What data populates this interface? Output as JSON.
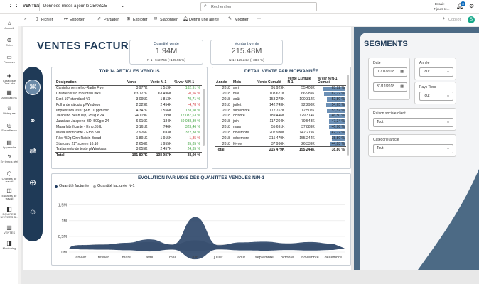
{
  "topbar": {
    "app": "VENTES",
    "data_updated": "Données mises à jour le 25/03/25",
    "search_placeholder": "Rechercher",
    "trial_line1": "Essai :",
    "trial_line2": "7 jours re...",
    "notif_count": "3"
  },
  "toolbar": {
    "fichier": "Fichier",
    "exporter": "Exporter",
    "partager": "Partager",
    "explorer": "Explorer",
    "abonner": "S'abonner",
    "alerte": "Définir une alerte",
    "modifier": "Modifier",
    "more": "···",
    "copilot": "Copilot"
  },
  "rail": [
    {
      "label": "Accueil",
      "icon": "home-icon",
      "glyph": "⌂"
    },
    {
      "label": "Créer",
      "icon": "plus-icon",
      "glyph": "⊕"
    },
    {
      "label": "Parcourir",
      "icon": "folder-icon",
      "glyph": "▭"
    },
    {
      "label": "Catalogue OneLake",
      "icon": "catalog-icon",
      "glyph": "◈"
    },
    {
      "label": "Applications",
      "icon": "apps-icon",
      "glyph": "▦"
    },
    {
      "label": "Métriques",
      "icon": "trophy-icon",
      "glyph": "♕"
    },
    {
      "label": "Surveillance",
      "icon": "monitor-icon",
      "glyph": "◎"
    },
    {
      "label": "Apprendre",
      "icon": "book-icon",
      "glyph": "▤"
    },
    {
      "label": "En temps réel",
      "icon": "lightning-icon",
      "glyph": "ϟ"
    },
    {
      "label": "Charges de travail",
      "icon": "workload-icon",
      "glyph": "⬡"
    },
    {
      "label": "Espaces de travail",
      "icon": "workspace-icon",
      "glyph": "◫"
    },
    {
      "label": "EQUIPE B UNIVERS B...",
      "icon": "workspace-b-icon",
      "glyph": "◧"
    },
    {
      "label": "VENTES",
      "icon": "report-icon",
      "glyph": "▥"
    },
    {
      "label": "Monitoring",
      "icon": "monitoring-icon",
      "glyph": "◨"
    }
  ],
  "report": {
    "title": "VENTES FACTURES",
    "kpi1": {
      "label": "Quantité vente",
      "value": "1.94M",
      "sub": "N-1 : 942.76K (+105.55 %)"
    },
    "kpi2": {
      "label": "Montant vente",
      "value": "215.48M",
      "sub": "N-1 : 155.24M (+38.8 %)"
    },
    "top_title": "TOP 14 ARTICLES VENDUS",
    "top_headers": [
      "Désignation",
      "Vente",
      "Vente N-1",
      "% var N/N-1"
    ],
    "top_rows": [
      [
        "Carrinho vermelho-Radio Flyer",
        "3 977K",
        "1 519K",
        "162,91 %",
        "pos"
      ],
      [
        "Children's std mountain bike",
        "63 127K",
        "63 496K",
        "-0,56 %",
        "neg"
      ],
      [
        "Ecrã 19\" standard 4/3",
        "3 095K",
        "1 813K",
        "70,71 %",
        "pos"
      ],
      [
        "Folha de cálculo p/Windows",
        "2 329K",
        "2 454K",
        "-4,78 %",
        "neg"
      ],
      [
        "Impressora laser p&b 10 ppm/min",
        "4 347K",
        "1 556K",
        "178,50 %",
        "pos"
      ],
      [
        "Jalapeno Bean Dip, 250g x 24",
        "24 119K",
        "199K",
        "12 087,63 %",
        "pos"
      ],
      [
        "Juanita's Jalapeno BD, 500g x 24",
        "6 016K",
        "184K",
        "50 038,39 %",
        "pos"
      ],
      [
        "Masa lubrificante - Emb.35 lb",
        "3 161K",
        "746K",
        "323,46 %",
        "pos"
      ],
      [
        "Masa lubrificante - Emb.5 lb",
        "2 926K",
        "693K",
        "322,38 %",
        "pos"
      ],
      [
        "Pão 450g Cinn Raisin Bread",
        "1 891K",
        "1 915K",
        "-1,35 %",
        "neg"
      ],
      [
        "Standard 22\" screen 16:10",
        "2 656K",
        "1 955K",
        "35,85 %",
        "pos"
      ],
      [
        "Tratamento de texto p/Windows",
        "3 055K",
        "2 457K",
        "24,35 %",
        "pos"
      ]
    ],
    "top_total": [
      "Total",
      "191 807K",
      "138 987K",
      "38,00 %"
    ],
    "detail_title": "DETAIL VENTE PAR MOIS/ANNÉE",
    "detail_headers": [
      "Année",
      "Mois",
      "Vente Cumulé",
      "Vente Cumulé N-1",
      "% var N/N-1 Cumulé"
    ],
    "detail_rows": [
      [
        "2018",
        "avril",
        "91 929K",
        "55 406K",
        "65,92 %",
        65.92
      ],
      [
        "2018",
        "mai",
        "108 671K",
        "66 989K",
        "62,22 %",
        62.22
      ],
      [
        "2018",
        "août",
        "153 278K",
        "100 312K",
        "52,80 %",
        52.8
      ],
      [
        "2018",
        "juillet",
        "142 743K",
        "92 298K",
        "54,65 %",
        54.65
      ],
      [
        "2018",
        "septembre",
        "172 767K",
        "112 502K",
        "53,57 %",
        53.57
      ],
      [
        "2018",
        "octobre",
        "189 446K",
        "129 314K",
        "46,50 %",
        46.5
      ],
      [
        "2018",
        "juin",
        "117 204K",
        "79 548K",
        "47,34 %",
        47.34
      ],
      [
        "2018",
        "mars",
        "55 691K",
        "37 889K",
        "46,98 %",
        46.98
      ],
      [
        "2018",
        "novembre",
        "202 980K",
        "142 219K",
        "42,72 %",
        42.72
      ],
      [
        "2018",
        "décembre",
        "215 479K",
        "155 244K",
        "38,80 %",
        38.8
      ],
      [
        "2018",
        "février",
        "37 936K",
        "26 339K",
        "44,03 %",
        44.03
      ]
    ],
    "detail_total": [
      "Total",
      "",
      "215 479K",
      "155 244K",
      "38,80 %"
    ],
    "chart_title": "EVOLUTION PAR MOIS DES QUANTITÉS VENDUES N/N-1"
  },
  "chart_data": {
    "type": "area",
    "title": "EVOLUTION PAR MOIS DES QUANTITÉS VENDUES N/N-1",
    "categories": [
      "janvier",
      "février",
      "mars",
      "avril",
      "mai",
      "juin",
      "juillet",
      "août",
      "septembre",
      "octobre",
      "novembre",
      "décembre"
    ],
    "series": [
      {
        "name": "Quantité facturée",
        "color": "#1f3a5f",
        "values": [
          0.02,
          0.05,
          0.15,
          0.35,
          0.05,
          1.65,
          0.02,
          0.18,
          0.22,
          0.12,
          0.2,
          0.1
        ]
      },
      {
        "name": "Quantité facturée N-1",
        "color": "#a5a5a5",
        "values": [
          0.03,
          0.08,
          0.12,
          0.2,
          0.06,
          0.3,
          0.05,
          0.1,
          0.14,
          0.1,
          0.12,
          0.08
        ]
      }
    ],
    "yticks": [
      "0M",
      "0,5M",
      "1M",
      "1,5M"
    ],
    "ytick_values": [
      0,
      0.5,
      1,
      1.5
    ],
    "ylim": [
      0,
      1.9
    ],
    "legend": "top-left"
  },
  "segments": {
    "title": "SEGMENTS",
    "date_label": "Date",
    "date_from": "01/01/2018",
    "date_to": "31/12/2018",
    "annee_label": "Année",
    "annee_value": "Tout",
    "pays_label": "Pays Tiers",
    "pays_value": "Tout",
    "raison_label": "Raison sociale client",
    "raison_value": "Tout",
    "categorie_label": "Catégorie article",
    "categorie_value": "Tout"
  },
  "colors": {
    "accent": "#1f3a57",
    "teal": "#17a98a",
    "panel": "#4c6a85",
    "positive": "#3aa03a",
    "negative": "#d13438",
    "bar": "#6b8fb5"
  }
}
